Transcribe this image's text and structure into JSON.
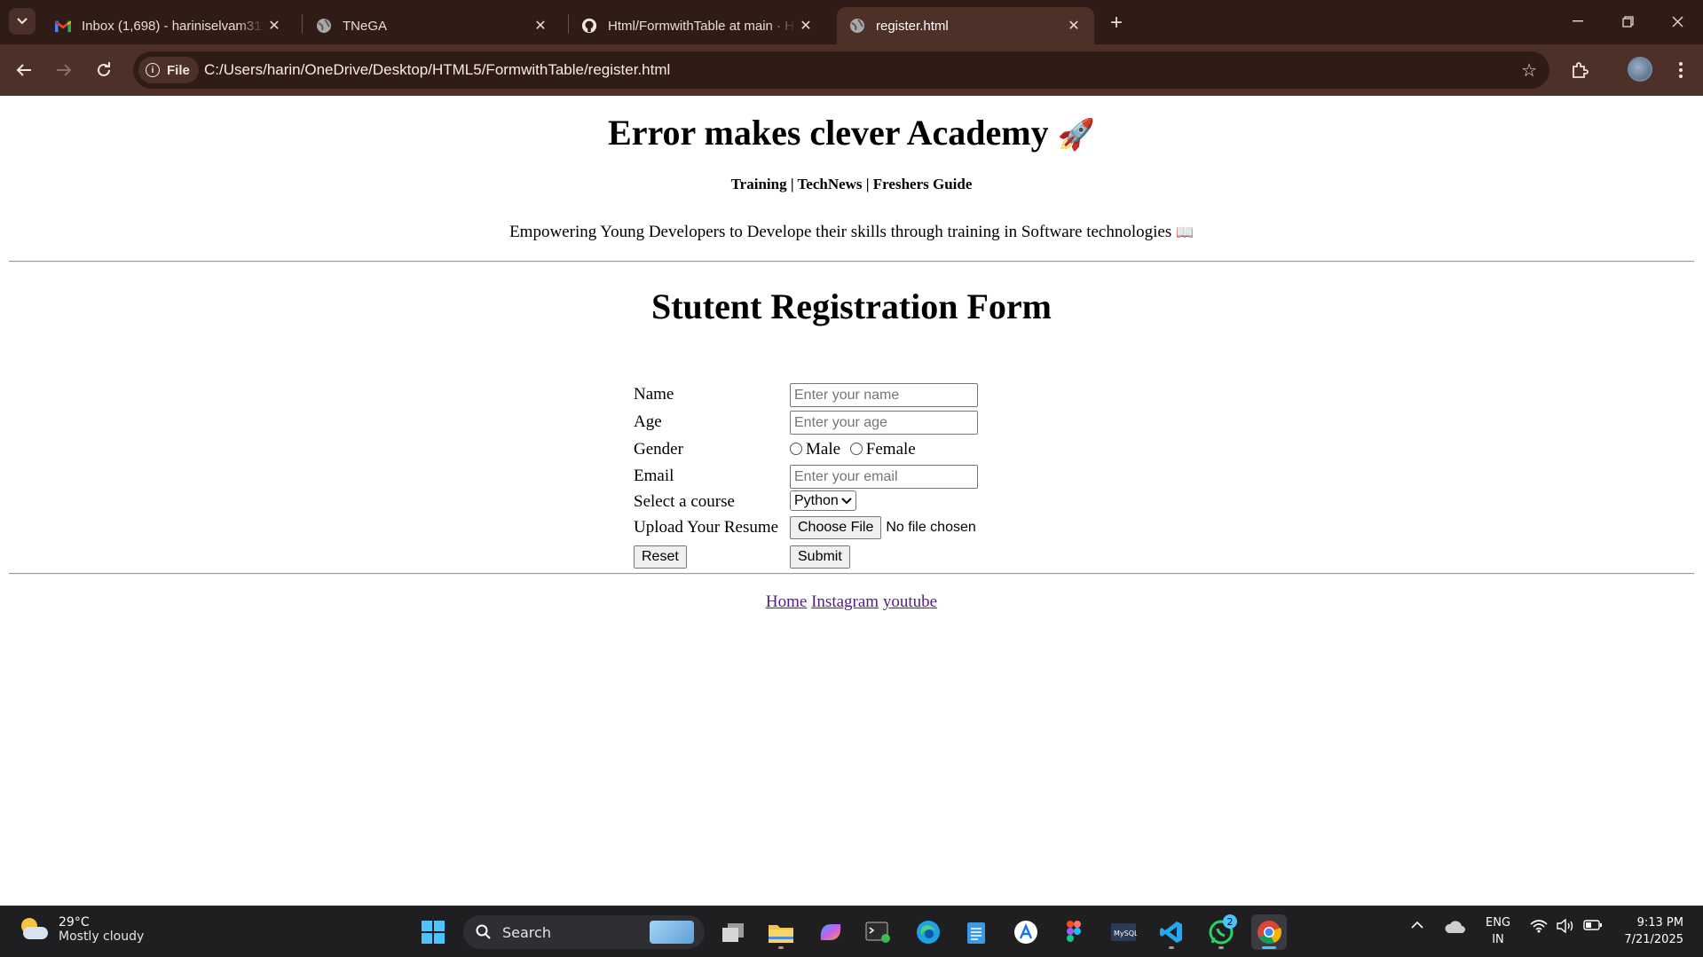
{
  "browser": {
    "tabs": [
      {
        "title": "Inbox (1,698) - hariniselvam311",
        "icon": "gmail-icon"
      },
      {
        "title": "TNeGA",
        "icon": "globe-icon"
      },
      {
        "title": "Html/FormwithTable at main · H",
        "icon": "github-icon"
      },
      {
        "title": "register.html",
        "icon": "globe-icon"
      }
    ],
    "site_chip": "File",
    "url": "C:/Users/harin/OneDrive/Desktop/HTML5/FormwithTable/register.html"
  },
  "page": {
    "site_title": "Error makes clever Academy",
    "title_emoji": "🚀",
    "nav": "Training | TechNews | Freshers Guide",
    "tagline": "Empowering Young Developers to Develope their skills through training in Software technologies",
    "tagline_emoji": "📖",
    "form_title": "Stutent Registration Form",
    "form": {
      "name_label": "Name",
      "name_placeholder": "Enter your name",
      "age_label": "Age",
      "age_placeholder": "Enter your age",
      "gender_label": "Gender",
      "gender_male": "Male",
      "gender_female": "Female",
      "email_label": "Email",
      "email_placeholder": "Enter your email",
      "course_label": "Select a course",
      "course_selected": "Python",
      "resume_label": "Upload Your Resume",
      "choose_file": "Choose File",
      "no_file": "No file chosen",
      "reset": "Reset",
      "submit": "Submit"
    },
    "footer_links": [
      "Home",
      "Instagram",
      "youtube"
    ]
  },
  "taskbar": {
    "temperature": "29°C",
    "weather": "Mostly cloudy",
    "search": "Search",
    "lang_top": "ENG",
    "lang_bottom": "IN",
    "time": "9:13 PM",
    "date": "7/21/2025",
    "whatsapp_badge": "2"
  },
  "colors": {
    "tabstrip": "#2f1c16",
    "toolbar": "#4d3128",
    "link_visited": "#551a8b",
    "taskbar": "#1f1f22"
  }
}
